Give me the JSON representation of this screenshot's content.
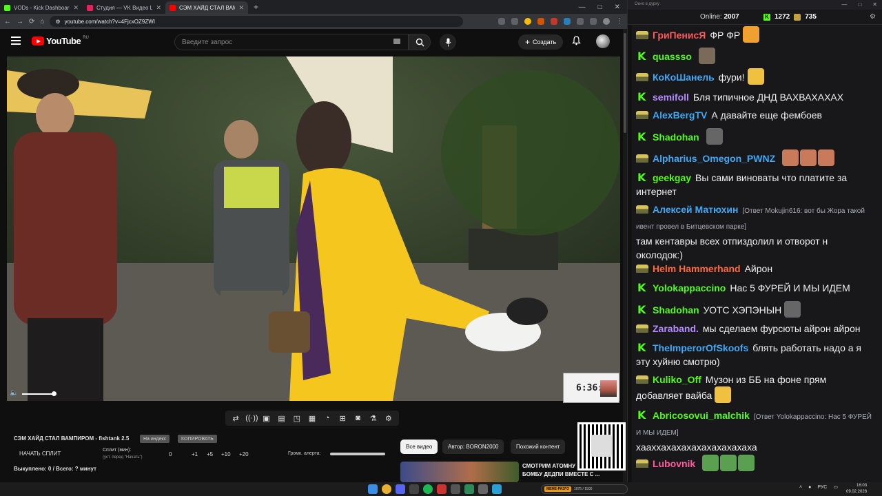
{
  "browser": {
    "tabs": [
      {
        "label": "VODs - Kick Dashboard",
        "color": "#53fc18"
      },
      {
        "label": "Студия — VK Видео Live",
        "color": "#e0245e"
      },
      {
        "label": "СЭМ ХАЙД СТАЛ ВАМПИ",
        "color": "#ff0000",
        "active": true
      }
    ],
    "new_tab": "+",
    "window_controls": [
      "—",
      "□",
      "✕"
    ],
    "nav": [
      "←",
      "→",
      "⟳",
      "⌂"
    ],
    "url": "youtube.com/watch?v=4FjcxOZ9ZWI"
  },
  "youtube": {
    "logo_text": "YouTube",
    "logo_region": "RU",
    "search_placeholder": "Введите запрос",
    "create_label": "Создать"
  },
  "video": {
    "cam_clock": "6:36:"
  },
  "toolbar_icons": [
    "repeat-icon",
    "broadcast-icon",
    "screen-icon",
    "film-icon",
    "pip-icon",
    "frames-icon",
    "speed-icon",
    "add-icon",
    "camera-icon",
    "flask-icon",
    "gear-icon"
  ],
  "panel": {
    "title": "СЭМ ХАЙД СТАЛ ВАМПИРОМ - fishtank 2.5",
    "pill_1": "На индекс",
    "pill_2": "КОПИРОВАТЬ",
    "start_split": "НАЧАТЬ СПЛИТ",
    "split_label": "Сплит (мин):",
    "split_hint": "(уст. перед \"Начать\")",
    "split_value": "0",
    "increments": [
      "+1",
      "+5",
      "+10",
      "+20"
    ],
    "alert_volume_label": "Громк. алерта:",
    "bought": "Выкуплено: 0 / Всего: ? минут"
  },
  "chips": [
    "Все видео",
    "Автор: BORON2000",
    "Похожий контент"
  ],
  "recommendation": {
    "line1": "СМОТРИМ АТОМНУ",
    "line2": "БОМБУ ДЕДПИ ВМЕСТЕ С ..."
  },
  "chat": {
    "window_title": "Окно в дурку",
    "online_label": "Online:",
    "online_count": "2007",
    "kick_count": "1272",
    "tank_count": "735",
    "messages": [
      {
        "badge": "tank",
        "nick": "ГриПенисЯ",
        "color": "#ff5b5b",
        "text": "ФР ФР",
        "emote": "#f0a030"
      },
      {
        "badge": "kick",
        "nick": "quassso",
        "color": "#53fc18",
        "text": "",
        "emote": "#7a6a5a"
      },
      {
        "badge": "tank",
        "nick": "КоКоШанель",
        "color": "#3fa9f5",
        "text": "фури!",
        "emote": "#f0c040"
      },
      {
        "badge": "kick",
        "nick": "semifoll",
        "color": "#b48cff",
        "text": "Бля типичное ДНД ВАХВАХАХАХ"
      },
      {
        "badge": "tank",
        "nick": "AlexBergTV",
        "color": "#3fa9f5",
        "text": "А давайте еще фембоев"
      },
      {
        "badge": "kick",
        "nick": "Shadohan",
        "color": "#53fc18",
        "text": "",
        "emote": "#666"
      },
      {
        "badge": "tank",
        "nick": "Alpharius_Omegon_PWNZ",
        "color": "#3fa9f5",
        "text": "",
        "emote": "#c97a5a"
      },
      {
        "badge": "kick",
        "nick": "geekgay",
        "color": "#53fc18",
        "text": "Вы сами виноваты что платите за интернет"
      },
      {
        "badge": "tank",
        "nick": "Алексей Матюхин",
        "color": "#3fa9f5",
        "reply": "[Ответ Mokujin616: вот бы Жора такой ивент провел в Битцевском парке]",
        "text": "там кентавры всех отпиздолил и отворот н околодок:)"
      },
      {
        "badge": "tank",
        "nick": "Helm Hammerhand",
        "color": "#ff6b3d",
        "text": "Айрон"
      },
      {
        "badge": "kick",
        "nick": "Yolokappaccino",
        "color": "#53fc18",
        "text": "Нас 5 ФУРЕЙ И МЫ ИДЕМ"
      },
      {
        "badge": "kick",
        "nick": "Shadohan",
        "color": "#53fc18",
        "text": "УОТС ХЭПЭНЫН",
        "emote": "#666"
      },
      {
        "badge": "tank",
        "nick": "Zaraband.",
        "color": "#b48cff",
        "text": "мы сделаем фурсюты айрон айрон"
      },
      {
        "badge": "kick",
        "nick": "TheImperorOfSkoofs",
        "color": "#3fa9f5",
        "text": "блять работать надо а я эту хуйню смотрю)"
      },
      {
        "badge": "tank",
        "nick": "Kuliko_Off",
        "color": "#53fc18",
        "text": "Музон из ББ на фоне прям добавляет вайба",
        "emote": "#f0c040"
      },
      {
        "badge": "kick",
        "nick": "Abricosovui_malchik",
        "color": "#53fc18",
        "reply": "[Ответ Yolokappaccino: Нас 5 ФУРЕЙ И МЫ ИДЕМ]",
        "text": "хааххахахахахахахахахаха"
      },
      {
        "badge": "tank",
        "nick": "Lubovnik",
        "color": "#ff5b9b",
        "text": "",
        "emote": "#5aa050"
      }
    ]
  },
  "taskbar": {
    "media_tag": "МЕМЕ-РАЗГО",
    "media_text": "1075 / 1500",
    "lang": "РУС",
    "time": "16:03",
    "date": "09.02.2026"
  }
}
